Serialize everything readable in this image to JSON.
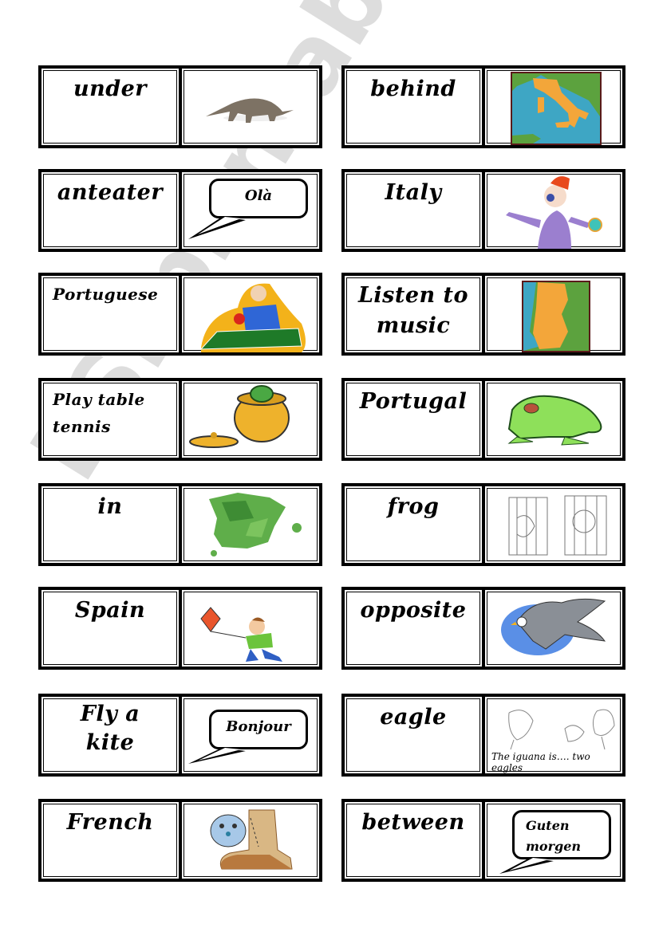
{
  "document": {
    "type": "domino word-picture cards",
    "watermark": "ESLprintables.com"
  },
  "cards": [
    {
      "word": "under",
      "picture": "anteater-icon"
    },
    {
      "word": "behind",
      "picture": "italy-map-icon"
    },
    {
      "word": "anteater",
      "picture": "speech-bubble-icon",
      "bubble_text": "Olà"
    },
    {
      "word": "Italy",
      "picture": "listening-music-icon"
    },
    {
      "word": "Portuguese",
      "picture": "table-tennis-player-icon"
    },
    {
      "word": "Listen to music",
      "picture": "portugal-map-icon"
    },
    {
      "word": "Play table tennis",
      "picture": "frog-in-pot-icon"
    },
    {
      "word": "Portugal",
      "picture": "frog-icon"
    },
    {
      "word": "in",
      "picture": "spain-map-icon"
    },
    {
      "word": "frog",
      "picture": "lion-cage-sketch-icon"
    },
    {
      "word": "Spain",
      "picture": "boy-flying-kite-icon"
    },
    {
      "word": "opposite",
      "picture": "eagle-icon"
    },
    {
      "word": "Fly a kite",
      "picture": "speech-bubble-icon",
      "bubble_text": "Bonjour"
    },
    {
      "word": "eagle",
      "picture": "birds-sketch-icon",
      "caption": "The iguana is…. two eagles"
    },
    {
      "word": "French",
      "picture": "cat-in-boot-icon"
    },
    {
      "word": "between",
      "picture": "speech-bubble-icon",
      "bubble_text": "Guten morgen"
    }
  ]
}
